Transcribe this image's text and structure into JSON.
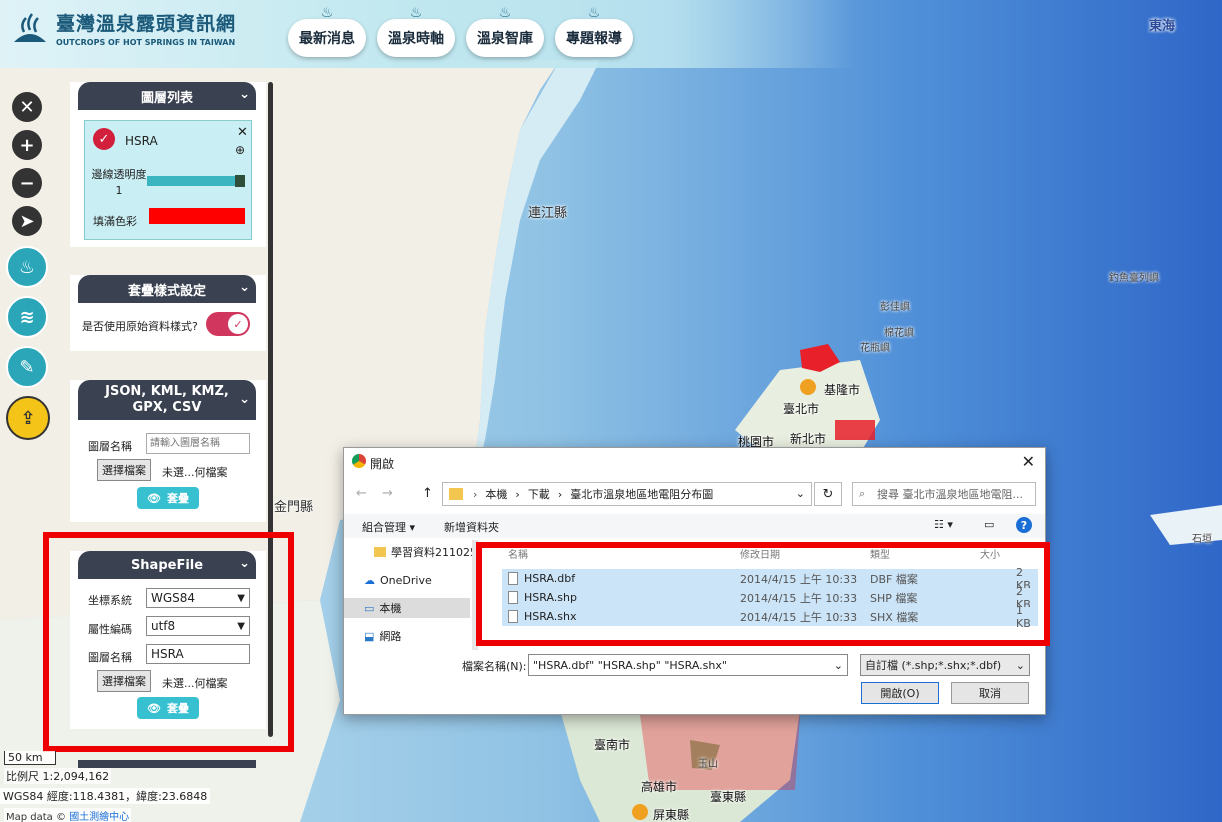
{
  "header": {
    "logo_title": "臺灣溫泉露頭資訊網",
    "logo_subtitle": "OUTCROPS OF HOT SPRINGS IN TAIWAN",
    "nav": [
      {
        "label": "最新消息"
      },
      {
        "label": "溫泉時軸"
      },
      {
        "label": "溫泉智庫"
      },
      {
        "label": "專題報導"
      }
    ]
  },
  "map": {
    "labels": {
      "east_sea": "東海",
      "lienchiang": "連江縣",
      "kinmen": "金門縣",
      "diaoyu": "釣魚臺列嶼",
      "pengjia": "彭佳嶼",
      "mianhua": "棉花嶼",
      "huaping": "花瓶嶼",
      "keelung": "基隆市",
      "taipei": "臺北市",
      "newtaipei": "新北市",
      "taoyuan": "桃園市",
      "tainan": "臺南市",
      "kaohsiung": "高雄市",
      "taitung": "臺東縣",
      "pingtung": "屏東縣",
      "shishan": "石垣",
      "yushan": "玉山"
    },
    "scale": "50 km",
    "ratio": "比例尺 1:2,094,162",
    "coords": "WGS84 經度:118.4381，緯度:23.6848",
    "credit_prefix": "Map data ©",
    "credit_link": "國土測繪中心"
  },
  "layer_panel": {
    "title": "圖層列表",
    "layer_name": "HSRA",
    "opacity_label": "邊線透明度 1",
    "fill_label": "填滿色彩",
    "fill_color": "#ff0000"
  },
  "style_panel": {
    "title": "套疊樣式設定",
    "use_original_label": "是否使用原始資料樣式?"
  },
  "json_panel": {
    "title": "JSON, KML, KMZ, GPX, CSV",
    "name_label": "圖層名稱",
    "name_placeholder": "請輸入圖層名稱",
    "file_button": "選擇檔案",
    "file_status": "未選...何檔案",
    "view_button": "套疊"
  },
  "shape_panel": {
    "title": "ShapeFile",
    "crs_label": "坐標系統",
    "crs_value": "WGS84",
    "enc_label": "屬性編碼",
    "enc_value": "utf8",
    "name_label": "圖層名稱",
    "name_value": "HSRA",
    "file_button": "選擇檔案",
    "file_status": "未選...何檔案",
    "view_button": "套疊"
  },
  "dialog": {
    "title": "開啟",
    "path": [
      "本機",
      "下載",
      "臺北市溫泉地區地電阻分布圖"
    ],
    "search_placeholder": "搜尋 臺北市溫泉地區地電阻...",
    "organize": "組合管理",
    "new_folder": "新增資料夾",
    "nav_items": [
      "學習資料211025",
      "OneDrive",
      "本機",
      "網路"
    ],
    "columns": [
      "名稱",
      "修改日期",
      "類型",
      "大小"
    ],
    "files": [
      {
        "name": "HSRA.dbf",
        "date": "2014/4/15 上午 10:33",
        "type": "DBF 檔案",
        "size": "2 KB"
      },
      {
        "name": "HSRA.shp",
        "date": "2014/4/15 上午 10:33",
        "type": "SHP 檔案",
        "size": "2 KB"
      },
      {
        "name": "HSRA.shx",
        "date": "2014/4/15 上午 10:33",
        "type": "SHX 檔案",
        "size": "1 KB"
      }
    ],
    "filename_label": "檔案名稱(N):",
    "filename_value": "\"HSRA.dbf\" \"HSRA.shp\" \"HSRA.shx\"",
    "filetype_value": "自訂檔 (*.shp;*.shx;*.dbf)",
    "open_button": "開啟(O)",
    "cancel_button": "取消"
  },
  "colors": {
    "accent": "#36c0d0",
    "panel_header": "#3a4150",
    "highlight": "#ee0000"
  }
}
